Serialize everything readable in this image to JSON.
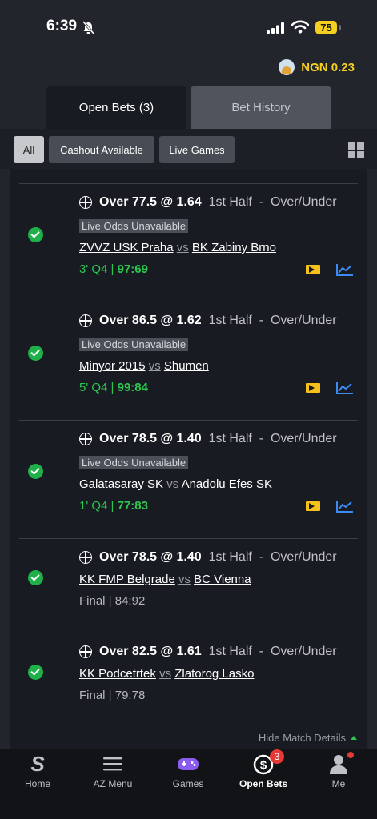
{
  "status_bar": {
    "time": "6:39",
    "battery": "75"
  },
  "header": {
    "balance": "NGN 0.23"
  },
  "tabs": [
    {
      "label": "Open Bets (3)",
      "active": true
    },
    {
      "label": "Bet History",
      "active": false
    }
  ],
  "filters": [
    {
      "label": "All",
      "active": true
    },
    {
      "label": "Cashout Available",
      "active": false
    },
    {
      "label": "Live Games",
      "active": false
    }
  ],
  "bets": [
    {
      "selection": "Over 77.5 @ 1.64",
      "period": "1st Half",
      "sep": "-",
      "market": "Over/Under",
      "odds_note": "Live Odds Unavailable",
      "home": "ZVVZ USK Praha",
      "vs": "vs",
      "away": "BK Zabiny Brno",
      "time": "3' Q4 |",
      "score": "97:69",
      "status": "live"
    },
    {
      "selection": "Over 86.5 @ 1.62",
      "period": "1st Half",
      "sep": "-",
      "market": "Over/Under",
      "odds_note": "Live Odds Unavailable",
      "home": "Minyor 2015",
      "vs": "vs",
      "away": "Shumen",
      "time": "5' Q4 |",
      "score": "99:84",
      "status": "live"
    },
    {
      "selection": "Over 78.5 @ 1.40",
      "period": "1st Half",
      "sep": "-",
      "market": "Over/Under",
      "odds_note": "Live Odds Unavailable",
      "home": "Galatasaray SK",
      "vs": "vs",
      "away": "Anadolu Efes SK",
      "time": "1' Q4 |",
      "score": "77:83",
      "status": "live"
    },
    {
      "selection": "Over 78.5 @ 1.40",
      "period": "1st Half",
      "sep": "-",
      "market": "Over/Under",
      "home": "KK FMP Belgrade",
      "vs": "vs",
      "away": "BC Vienna",
      "result": "Final | 84:92",
      "status": "final"
    },
    {
      "selection": "Over 82.5 @ 1.61",
      "period": "1st Half",
      "sep": "-",
      "market": "Over/Under",
      "home": "KK Podcetrtek",
      "vs": "vs",
      "away": "Zlatorog Lasko",
      "result": "Final | 79:78",
      "status": "final"
    }
  ],
  "footer": {
    "hide_details": "Hide Match Details"
  },
  "nav": [
    {
      "label": "Home",
      "icon": "sportybet-logo-icon"
    },
    {
      "label": "AZ Menu",
      "icon": "hamburger-menu-icon"
    },
    {
      "label": "Games",
      "icon": "gamepad-icon"
    },
    {
      "label": "Open Bets",
      "icon": "open-bets-icon",
      "badge": "3",
      "active": true
    },
    {
      "label": "Me",
      "icon": "user-icon"
    }
  ],
  "colors": {
    "accent_green": "#2ec650",
    "yellow": "#f5d020",
    "badge_red": "#e53935",
    "chart_blue": "#3d8bf2"
  }
}
